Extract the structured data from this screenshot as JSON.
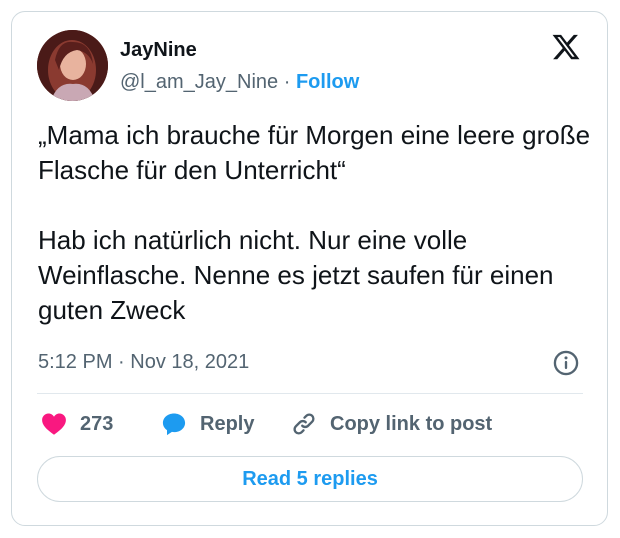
{
  "author": {
    "name": "JayNine",
    "handle": "@l_am_Jay_Nine",
    "separator": "·",
    "follow_label": "Follow"
  },
  "tweet": {
    "text": "„Mama ich brauche für Morgen eine leere große Flasche für den Unterricht“\n\nHab ich natürlich nicht. Nur eine volle Weinflasche. Nenne es jetzt saufen für einen guten Zweck",
    "timestamp": "5:12 PM · Nov 18, 2021"
  },
  "actions": {
    "like_count": "273",
    "reply_label": "Reply",
    "copy_label": "Copy link to post"
  },
  "replies_button": {
    "label": "Read 5 replies"
  },
  "icons": {
    "platform": "x-logo-icon",
    "info": "info-icon",
    "like": "heart-icon",
    "reply": "speech-bubble-icon",
    "copy": "link-icon"
  },
  "colors": {
    "accent": "#1d9bf0",
    "like": "#f91880",
    "muted": "#536471",
    "text": "#0f1419",
    "border": "#cfd9de"
  }
}
